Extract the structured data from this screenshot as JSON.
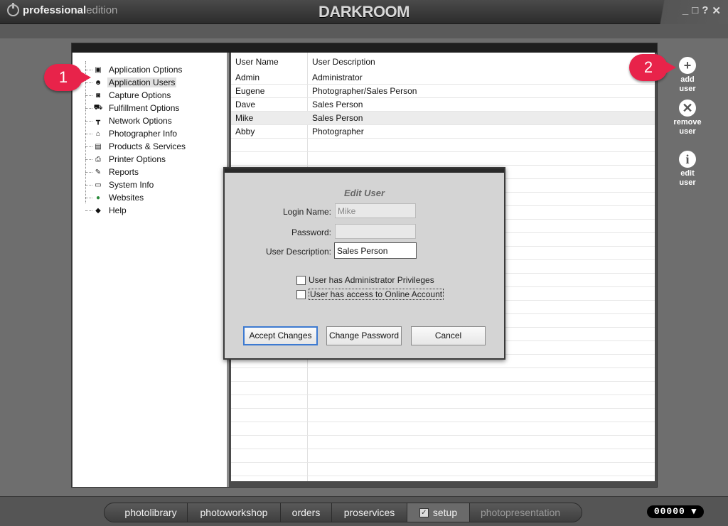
{
  "window": {
    "brand_bold": "professional",
    "brand_light": "edition",
    "logo": "DARKROOM",
    "minimize": "_",
    "maximize": "□",
    "help": "?",
    "close": "✕"
  },
  "tree": {
    "items": [
      {
        "label": "Application Options",
        "icon": "options-icon"
      },
      {
        "label": "Application Users",
        "icon": "users-icon"
      },
      {
        "label": "Capture Options",
        "icon": "camera-icon"
      },
      {
        "label": "Fulfillment Options",
        "icon": "cart-icon"
      },
      {
        "label": "Network Options",
        "icon": "network-icon"
      },
      {
        "label": "Photographer Info",
        "icon": "lock-icon"
      },
      {
        "label": "Products & Services",
        "icon": "product-icon"
      },
      {
        "label": "Printer Options",
        "icon": "printer-icon"
      },
      {
        "label": "Reports",
        "icon": "reports-icon"
      },
      {
        "label": "System Info",
        "icon": "computer-icon"
      },
      {
        "label": "Websites",
        "icon": "globe-icon"
      },
      {
        "label": "Help",
        "icon": "help-book-icon"
      }
    ],
    "selected": 1
  },
  "table": {
    "headers": [
      "User Name",
      "User Description"
    ],
    "rows": [
      [
        "Admin",
        "Administrator"
      ],
      [
        "Eugene",
        "Photographer/Sales Person"
      ],
      [
        "Dave",
        "Sales Person"
      ],
      [
        "Mike",
        "Sales Person"
      ],
      [
        "Abby",
        "Photographer"
      ]
    ],
    "selected_row": 3
  },
  "actions": {
    "add": {
      "line1": "add",
      "line2": "user"
    },
    "remove": {
      "line1": "remove",
      "line2": "user"
    },
    "edit": {
      "line1": "edit",
      "line2": "user"
    }
  },
  "callouts": {
    "c1": "1",
    "c2": "2"
  },
  "dialog": {
    "title": "Edit User",
    "login_label": "Login Name:",
    "login_value": "Mike",
    "password_label": "Password:",
    "password_value": "",
    "desc_label": "User Description:",
    "desc_value": "Sales Person",
    "admin_checkbox": "User has Administrator Privileges",
    "online_checkbox": "User has access to Online Account",
    "admin_checked": false,
    "online_checked": false,
    "accept": "Accept Changes",
    "change_password": "Change Password",
    "cancel": "Cancel"
  },
  "nav": {
    "tabs": [
      "photolibrary",
      "photoworkshop",
      "orders",
      "proservices",
      "setup",
      "photopresentation"
    ],
    "active": "setup"
  },
  "counter": "00000 ▾",
  "colors": {
    "accent_blue": "#3d7ad1",
    "callout_red": "#e8234a",
    "panel_gray": "#4a4a4a"
  }
}
